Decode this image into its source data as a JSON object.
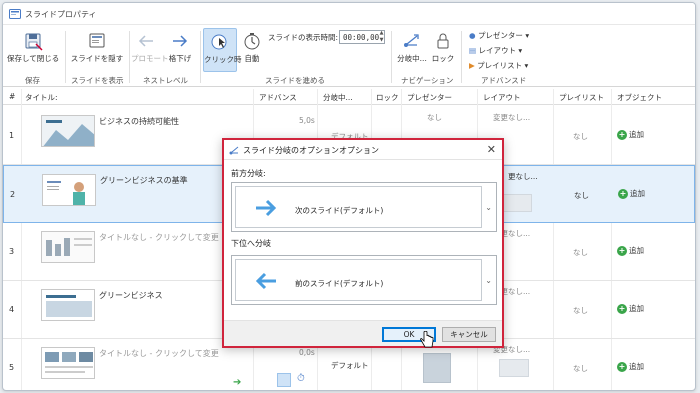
{
  "window": {
    "title": "スライドプロパティ"
  },
  "ribbon": {
    "save_close": "保存して閉じる",
    "hide_slide": "スライドを隠す",
    "promote": "プロモート",
    "demote": "格下げ",
    "on_click": "クリック時",
    "auto": "自動",
    "duration_label": "スライドの表示時間:",
    "duration_value": "00:00,00",
    "branch": "分岐中...",
    "lock": "ロック",
    "presenter": "プレゼンター",
    "layout": "レイアウト",
    "playlist": "プレイリスト",
    "groups": {
      "save": "保存",
      "show_slide": "スライドを表示",
      "nest_level": "ネストレベル",
      "advance_slide": "スライドを進める",
      "navigation": "ナビゲーション",
      "advanced": "アドバンスド"
    }
  },
  "table": {
    "headers": [
      "#",
      "タイトル:",
      "アドバンス",
      "分岐中...",
      "ロック",
      "プレゼンター",
      "レイアウト",
      "プレイリスト",
      "オブジェクト"
    ],
    "rows": [
      {
        "num": "1",
        "title": "ビジネスの持続可能性",
        "advance": "5,0s",
        "branch": "デフォルト",
        "presenter": "なし",
        "layout": "変更なし...",
        "playlist": "なし",
        "object": "追加"
      },
      {
        "num": "2",
        "title": "グリーンビジネスの基準",
        "advance": "",
        "branch": "",
        "presenter": "",
        "layout": "更なし...",
        "playlist": "なし",
        "object": "追加"
      },
      {
        "num": "3",
        "title": "タイトルなし - クリックして変更",
        "advance": "",
        "branch": "",
        "presenter": "",
        "layout": "変更なし...",
        "playlist": "なし",
        "object": "追加"
      },
      {
        "num": "4",
        "title": "グリーンビジネス",
        "advance": "",
        "branch": "",
        "presenter": "",
        "layout": "変更なし...",
        "playlist": "なし",
        "object": "追加"
      },
      {
        "num": "5",
        "title": "タイトルなし - クリックして変更",
        "advance": "0,0s",
        "branch": "デフォルト",
        "presenter": "",
        "layout": "変更なし...",
        "playlist": "なし",
        "object": "追加"
      }
    ]
  },
  "dialog": {
    "title": "スライド分岐のオプションオプション",
    "forward_label": "前方分岐:",
    "forward_value": "次のスライド(デフォルト)",
    "down_label": "下位へ分岐",
    "down_value": "前のスライド(デフォルト)",
    "ok": "OK",
    "cancel": "キャンセル"
  },
  "colors": {
    "accent": "#0078d7",
    "highlight_border": "#d0243c",
    "arrow_blue": "#4a9ee0",
    "add_green": "#3aa54a"
  }
}
